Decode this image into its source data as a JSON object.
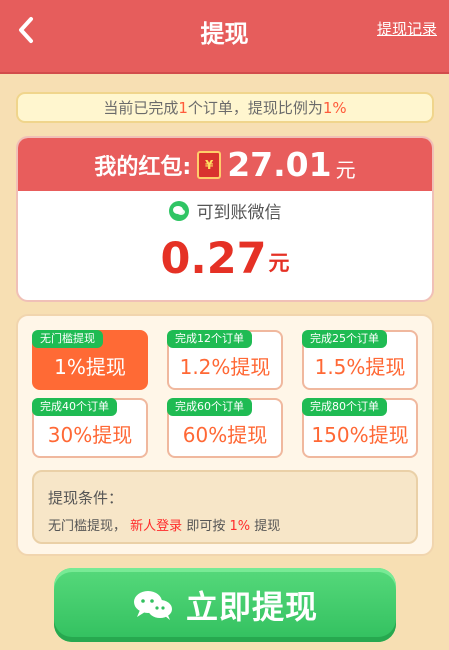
{
  "header": {
    "title": "提现",
    "record_link": "提现记录"
  },
  "notice": {
    "prefix": "当前已完成",
    "count": "1",
    "middle": "个订单，提现比例为",
    "rate": "1%"
  },
  "red_packet": {
    "label": "我的红包:",
    "envelope_icon": "¥",
    "amount": "27.01",
    "unit": "元",
    "wechat_text": "可到账微信",
    "withdraw_value": "0.27",
    "withdraw_unit": "元"
  },
  "options": [
    {
      "tag": "无门槛提现",
      "text": "1%提现",
      "selected": true
    },
    {
      "tag": "完成12个订单",
      "text": "1.2%提现",
      "selected": false
    },
    {
      "tag": "完成25个订单",
      "text": "1.5%提现",
      "selected": false
    },
    {
      "tag": "完成40个订单",
      "text": "30%提现",
      "selected": false
    },
    {
      "tag": "完成60个订单",
      "text": "60%提现",
      "selected": false
    },
    {
      "tag": "完成80个订单",
      "text": "150%提现",
      "selected": false
    }
  ],
  "conditions": {
    "title": "提现条件：",
    "part1": "无门槛提现，",
    "part2": "新人登录",
    "part3": "即可按",
    "part4": "1%",
    "part5": "提现"
  },
  "cta": {
    "label": "立即提现"
  }
}
